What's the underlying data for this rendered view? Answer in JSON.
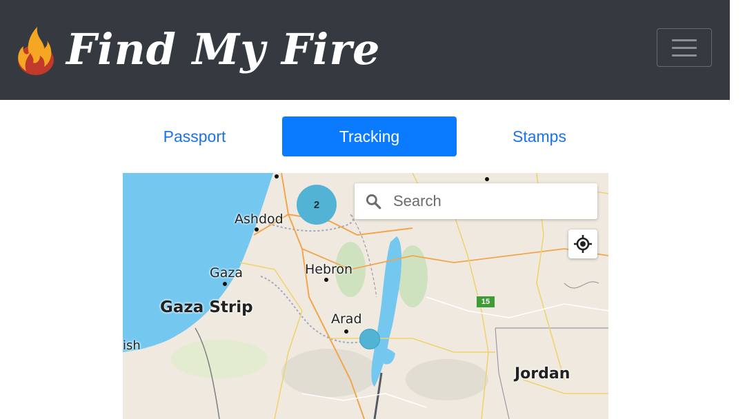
{
  "header": {
    "brand_title": "Find My Fire",
    "logo_icon": "flame-icon",
    "menu_icon": "hamburger-menu-icon"
  },
  "tabs": [
    {
      "label": "Passport",
      "active": false
    },
    {
      "label": "Tracking",
      "active": true
    },
    {
      "label": "Stamps",
      "active": false
    }
  ],
  "map": {
    "search": {
      "placeholder": "Search",
      "value": ""
    },
    "locate_icon": "crosshair-icon",
    "cluster_count": "2",
    "road_shield": "15",
    "labels": {
      "ashdod": "Ashdod",
      "gaza": "Gaza",
      "gaza_strip": "Gaza Strip",
      "hebron": "Hebron",
      "arad": "Arad",
      "jordan": "Jordan",
      "partial_left": "ish"
    }
  },
  "colors": {
    "navbar_bg": "#343a40",
    "active_tab_bg": "#0a7bff",
    "link_blue": "#1a73e8",
    "sea": "#74c8f0",
    "marker": "#52b3d5"
  }
}
